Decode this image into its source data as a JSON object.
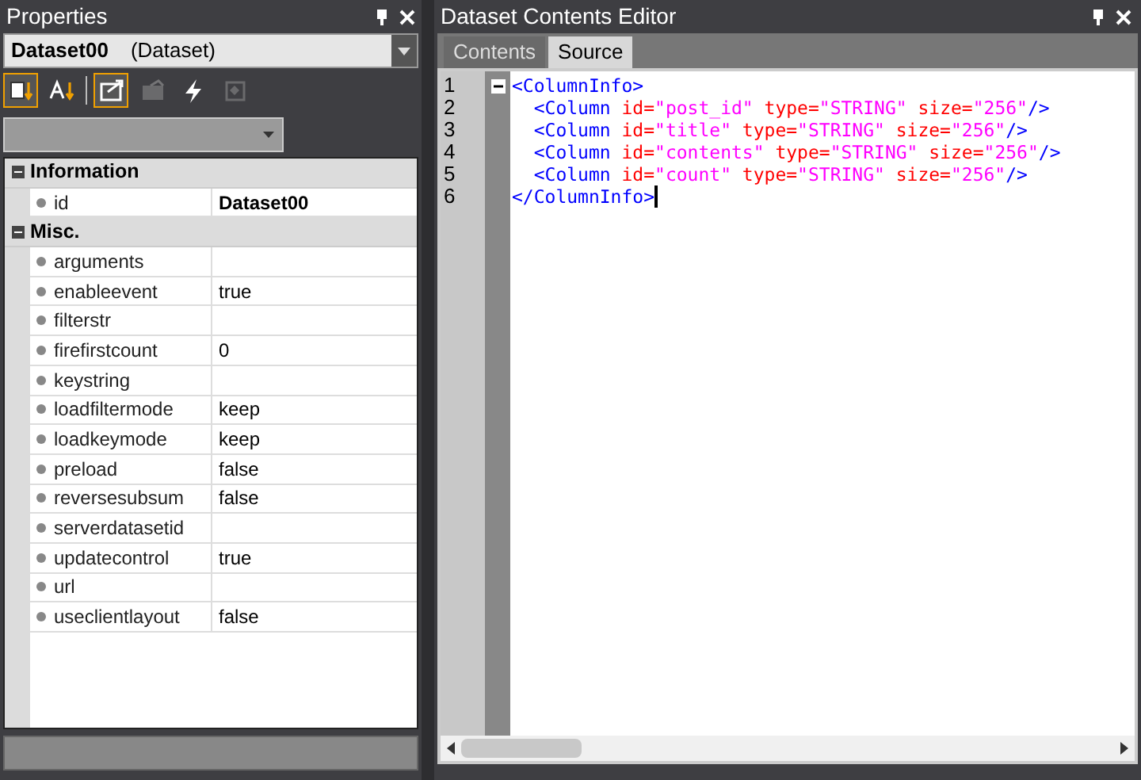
{
  "properties_panel": {
    "title": "Properties",
    "object": {
      "name": "Dataset00",
      "type": "(Dataset)"
    },
    "toolbar": [
      {
        "kind": "categorized",
        "selected": true,
        "disabled": false
      },
      {
        "kind": "alphabetical",
        "selected": false,
        "disabled": false
      },
      {
        "kind": "properties",
        "selected": true,
        "disabled": false
      },
      {
        "kind": "bindings",
        "selected": false,
        "disabled": true
      },
      {
        "kind": "events",
        "selected": false,
        "disabled": false
      },
      {
        "kind": "layout",
        "selected": false,
        "disabled": true
      }
    ],
    "categories": [
      {
        "name": "Information",
        "expanded": true,
        "children": [
          {
            "name": "id",
            "value": "Dataset00"
          }
        ]
      },
      {
        "name": "Misc.",
        "expanded": true,
        "children": [
          {
            "name": "arguments"
          },
          {
            "name": "enableevent",
            "value": "true"
          },
          {
            "name": "filterstr"
          },
          {
            "name": "firefirstcount",
            "value": "0"
          },
          {
            "name": "keystring"
          },
          {
            "name": "loadfiltermode",
            "value": "keep"
          },
          {
            "name": "loadkeymode",
            "value": "keep"
          },
          {
            "name": "preload",
            "value": "false"
          },
          {
            "name": "reversesubsum",
            "value": "false"
          },
          {
            "name": "serverdatasetid"
          },
          {
            "name": "updatecontrol",
            "value": "true"
          },
          {
            "name": "url"
          },
          {
            "name": "useclientlayout",
            "value": "false"
          }
        ]
      }
    ]
  },
  "editor_panel": {
    "title": "Dataset Contents Editor",
    "tabs": [
      {
        "label": "Contents",
        "selected": false
      },
      {
        "label": "Source",
        "selected": true
      }
    ],
    "lines": [
      {
        "number": "1",
        "expanded": true,
        "tokens": [
          {
            "text": "<ColumnInfo>",
            "kind": "tag"
          }
        ]
      },
      {
        "number": "2",
        "tokens": [
          {
            "text": "  <Column ",
            "kind": "tag"
          },
          {
            "text": "id=",
            "kind": "attr"
          },
          {
            "text": "\"post_id\" ",
            "kind": "value"
          },
          {
            "text": "type=",
            "kind": "attr"
          },
          {
            "text": "\"STRING\" ",
            "kind": "value"
          },
          {
            "text": "size=",
            "kind": "attr"
          },
          {
            "text": "\"256\"",
            "kind": "value"
          },
          {
            "text": "/>",
            "kind": "tag"
          }
        ]
      },
      {
        "number": "3",
        "tokens": [
          {
            "text": "  <Column ",
            "kind": "tag"
          },
          {
            "text": "id=",
            "kind": "attr"
          },
          {
            "text": "\"title\" ",
            "kind": "value"
          },
          {
            "text": "type=",
            "kind": "attr"
          },
          {
            "text": "\"STRING\" ",
            "kind": "value"
          },
          {
            "text": "size=",
            "kind": "attr"
          },
          {
            "text": "\"256\"",
            "kind": "value"
          },
          {
            "text": "/>",
            "kind": "tag"
          }
        ]
      },
      {
        "number": "4",
        "tokens": [
          {
            "text": "  <Column ",
            "kind": "tag"
          },
          {
            "text": "id=",
            "kind": "attr"
          },
          {
            "text": "\"contents\" ",
            "kind": "value"
          },
          {
            "text": "type=",
            "kind": "attr"
          },
          {
            "text": "\"STRING\" ",
            "kind": "value"
          },
          {
            "text": "size=",
            "kind": "attr"
          },
          {
            "text": "\"256\"",
            "kind": "value"
          },
          {
            "text": "/>",
            "kind": "tag"
          }
        ]
      },
      {
        "number": "5",
        "tokens": [
          {
            "text": "  <Column ",
            "kind": "tag"
          },
          {
            "text": "id=",
            "kind": "attr"
          },
          {
            "text": "\"count\" ",
            "kind": "value"
          },
          {
            "text": "type=",
            "kind": "attr"
          },
          {
            "text": "\"STRING\" ",
            "kind": "value"
          },
          {
            "text": "size=",
            "kind": "attr"
          },
          {
            "text": "\"256\"",
            "kind": "value"
          },
          {
            "text": "/>",
            "kind": "tag"
          }
        ]
      },
      {
        "number": "6",
        "tokens": [
          {
            "text": "</ColumnInfo>",
            "kind": "tag"
          }
        ]
      }
    ]
  }
}
